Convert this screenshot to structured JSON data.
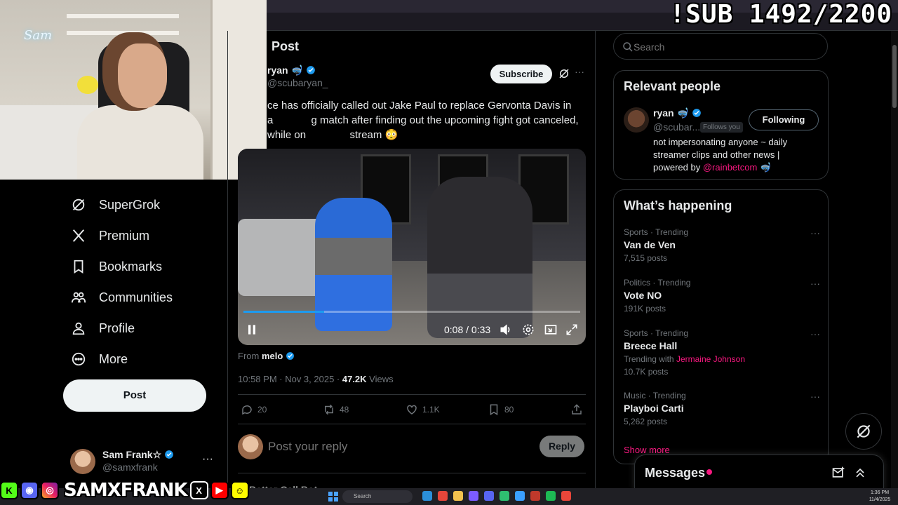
{
  "overlay": {
    "sub_counter": "!SUB 1492/2200",
    "social_name": "SAMXFRANK"
  },
  "nav": {
    "items": [
      {
        "label": "SuperGrok",
        "icon": "grok-icon"
      },
      {
        "label": "Premium",
        "icon": "x-logo-icon"
      },
      {
        "label": "Bookmarks",
        "icon": "bookmark-icon"
      },
      {
        "label": "Communities",
        "icon": "communities-icon"
      },
      {
        "label": "Profile",
        "icon": "profile-icon"
      },
      {
        "label": "More",
        "icon": "more-circle-icon"
      }
    ],
    "post_label": "Post",
    "account": {
      "name": "Sam Frank☆",
      "handle": "@samxfrank",
      "more": "···"
    }
  },
  "post": {
    "header_title": "Post",
    "author_name": "ryan 🤿",
    "author_handle": "@scubaryan_",
    "subscribe_label": "Subscribe",
    "more": "···",
    "text": "ce has officially called out Jake Paul to replace Gervonta Davis in a             g match after finding out the upcoming fight got canceled, while on               stream 😳",
    "video": {
      "time_current": "0:08",
      "time_total": "0:33",
      "time_sep": " / ",
      "progress": 0.24
    },
    "from_prefix": "From",
    "from_name": "melo",
    "timestamp": "10:58 PM · Nov 3, 2025 · ",
    "views_count": "47.2K",
    "views_label": " Views",
    "actions": {
      "replies": "20",
      "reposts": "48",
      "likes": "1.1K",
      "bookmarks": "80"
    },
    "reply_placeholder": "Post your reply",
    "reply_label": "Reply",
    "next_reply": "Better Call Bot"
  },
  "sidebar": {
    "search_placeholder": "Search",
    "relevant_title": "Relevant people",
    "relevant": {
      "name": "ryan 🤿",
      "handle": "@scubar...",
      "follows_you": "Follows you",
      "following_label": "Following",
      "bio": "not impersonating anyone ~ daily streamer clips and other news | powered by ",
      "bio_link": "@rainbetcom",
      "bio_end": " 🤿"
    },
    "happening_title": "What’s happening",
    "trends": [
      {
        "category": "Sports · Trending",
        "topic": "Van de Ven",
        "count": "7,515 posts"
      },
      {
        "category": "Politics · Trending",
        "topic": "Vote NO",
        "count": "191K posts"
      },
      {
        "category": "Sports · Trending",
        "topic": "Breece Hall",
        "with_prefix": "Trending with ",
        "with_name": "Jermaine Johnson",
        "count": "10.7K posts"
      },
      {
        "category": "Music · Trending",
        "topic": "Playboi Carti",
        "count": "5,262 posts"
      }
    ],
    "show_more": "Show more",
    "messages_title": "Messages"
  },
  "taskbar": {
    "search_label": "Search",
    "time": "1:36 PM",
    "date": "11/4/2025"
  },
  "colors": {
    "accent": "#1d9bf0",
    "pink": "#f91880",
    "muted": "#71767b"
  }
}
